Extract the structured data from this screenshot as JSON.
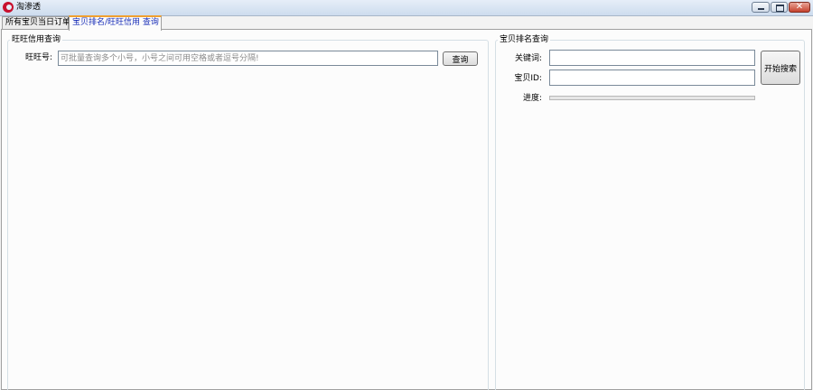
{
  "window": {
    "title": "淘渗透",
    "controls": {
      "minimize_icon": "minimize-icon",
      "maximize_icon": "maximize-icon",
      "close_icon": "close-icon",
      "close_glyph": "✕"
    }
  },
  "tabs": [
    {
      "label": "所有宝贝当日订单",
      "active": false
    },
    {
      "label": "宝贝排名/旺旺信用 查询",
      "active": true
    }
  ],
  "wangwang_group": {
    "title": "旺旺信用查询",
    "id_label": "旺旺号:",
    "id_value": "",
    "id_placeholder": "可批量查询多个小号，小号之间可用空格或者逗号分隔!",
    "query_button": "查询"
  },
  "ranking_group": {
    "title": "宝贝排名查询",
    "keyword_label": "关键词:",
    "keyword_value": "",
    "item_id_label": "宝贝ID:",
    "item_id_value": "",
    "progress_label": "进度:",
    "progress_value": 0,
    "search_button": "开始搜索"
  },
  "colors": {
    "active_tab_text": "#1a2fb8",
    "active_tab_accent": "#f0a030",
    "close_button": "#c5412d",
    "app_icon": "#c8102e"
  }
}
